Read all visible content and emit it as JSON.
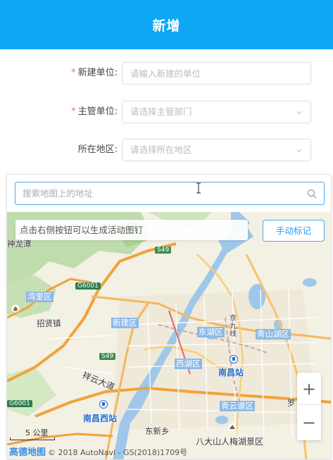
{
  "header": {
    "title": "新增"
  },
  "form": {
    "unit": {
      "label": "新建单位:",
      "required": true,
      "placeholder": "请输入新建的单位"
    },
    "dept": {
      "label": "主管单位:",
      "required": true,
      "placeholder": "请选择主管部门"
    },
    "region": {
      "label": "所在地区:",
      "required": false,
      "placeholder": "请选择所在地区"
    },
    "required_mark": "*"
  },
  "map": {
    "search_placeholder": "搜索地图上的地址",
    "hint": "点击右侧按钮可以生成活动图钉",
    "manual_mark_label": "手动标记",
    "zoom_in": "+",
    "zoom_out": "−",
    "scale_label": "5 公里",
    "logo": "高德地图",
    "copyright": "© 2018 AutoNavi - GS(2018)1709号",
    "places": {
      "shenlongtan": "神龙潭",
      "wanli": "湾里区",
      "zhaoxian": "招贤镇",
      "xinjian": "新建区",
      "donghu": "东湖区",
      "qingshanhu": "青山湖区",
      "xihu": "西湖区",
      "nanchang_station": "南昌站",
      "nanchang_west": "南昌西站",
      "qingyunpu": "青云谱区",
      "dongxin": "东新乡",
      "bada": "八大山人梅湖景区",
      "jingjiu": "京九线",
      "road_fengyun": "祥云大道",
      "luo": "罗"
    },
    "shields": {
      "s49a": "S49",
      "g6001a": "G6001",
      "s49b": "S49",
      "g6001b": "G6001"
    },
    "colors": {
      "accent": "#0ea7f5",
      "water": "#9ec7ea",
      "green": "#b9d9a6",
      "highway": "#f0a23a"
    }
  }
}
